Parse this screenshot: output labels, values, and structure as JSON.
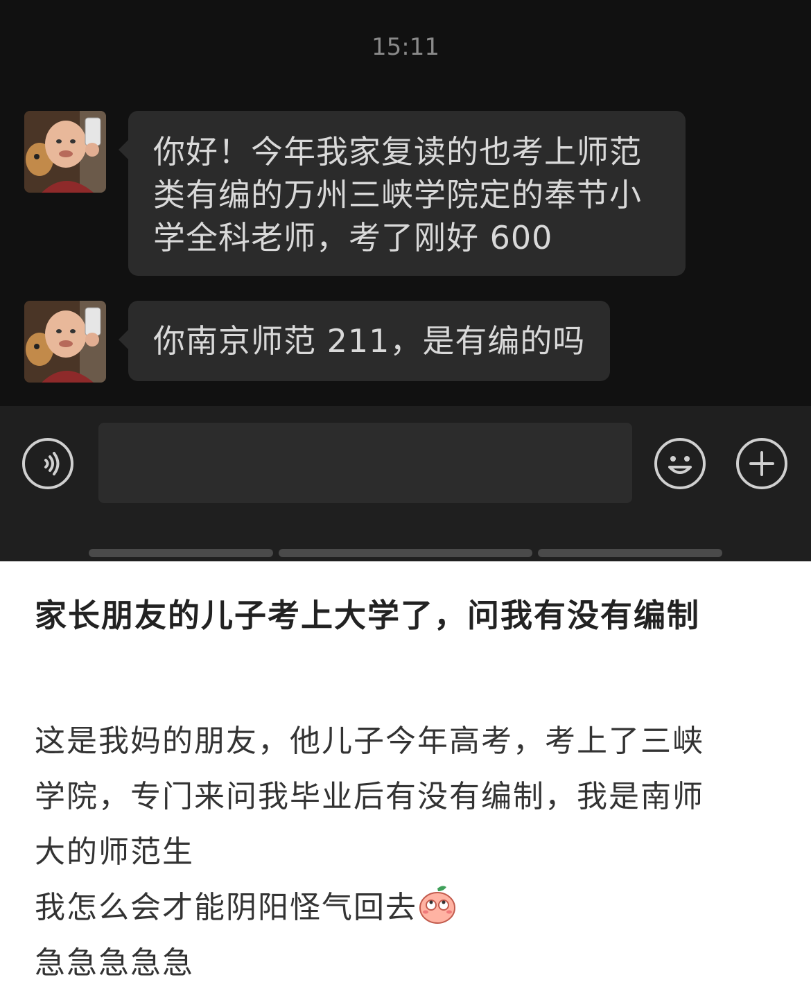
{
  "chat": {
    "timestamp": "15:11",
    "messages": [
      {
        "lines": [
          "你好！今年我家复读的也考上师范",
          "类有编的万州三峡学院定的奉节小",
          "学全科老师，考了刚好 600"
        ]
      },
      {
        "lines": [
          "你南京师范 211，是有编的吗"
        ]
      }
    ]
  },
  "input_bar": {
    "voice_icon": "voice-icon",
    "emoji_icon": "emoji-icon",
    "plus_icon": "plus-icon"
  },
  "post": {
    "title": "家长朋友的儿子考上大学了，问我有没有编制",
    "body_lines": [
      "这是我妈的朋友，他儿子今年高考，考上了三峡",
      "学院，专门来问我毕业后有没有编制，我是南师",
      "大的师范生",
      "我怎么会才能阴阳怪气回去",
      "急急急急急"
    ],
    "emoji_icon": "peach-eyeroll-emoji"
  }
}
